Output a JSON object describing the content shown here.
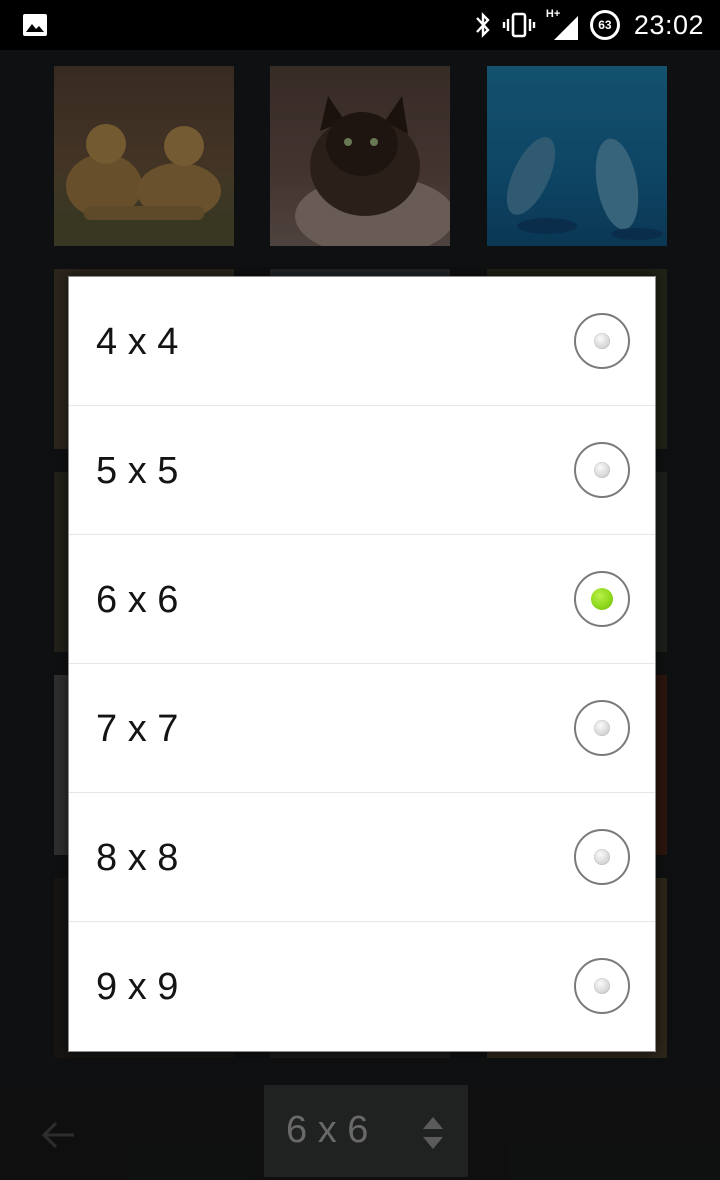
{
  "status_bar": {
    "time": "23:02",
    "battery_level": "63",
    "network_type": "H+",
    "icons": [
      "gallery-icon",
      "bluetooth-icon",
      "vibrate-icon",
      "signal-icon",
      "battery-icon"
    ]
  },
  "thumbnails": [
    {
      "name": "lions"
    },
    {
      "name": "cat"
    },
    {
      "name": "dolphins"
    }
  ],
  "dialog": {
    "options": [
      {
        "label": "4 x 4",
        "selected": false
      },
      {
        "label": "5 x 5",
        "selected": false
      },
      {
        "label": "6 x 6",
        "selected": true
      },
      {
        "label": "7 x 7",
        "selected": false
      },
      {
        "label": "8 x 8",
        "selected": false
      },
      {
        "label": "9 x 9",
        "selected": false
      }
    ],
    "accent_color": "#8fd91c"
  },
  "bottom_bar": {
    "spinner_value": "6 x 6",
    "back_icon": "arrow-left-icon"
  }
}
